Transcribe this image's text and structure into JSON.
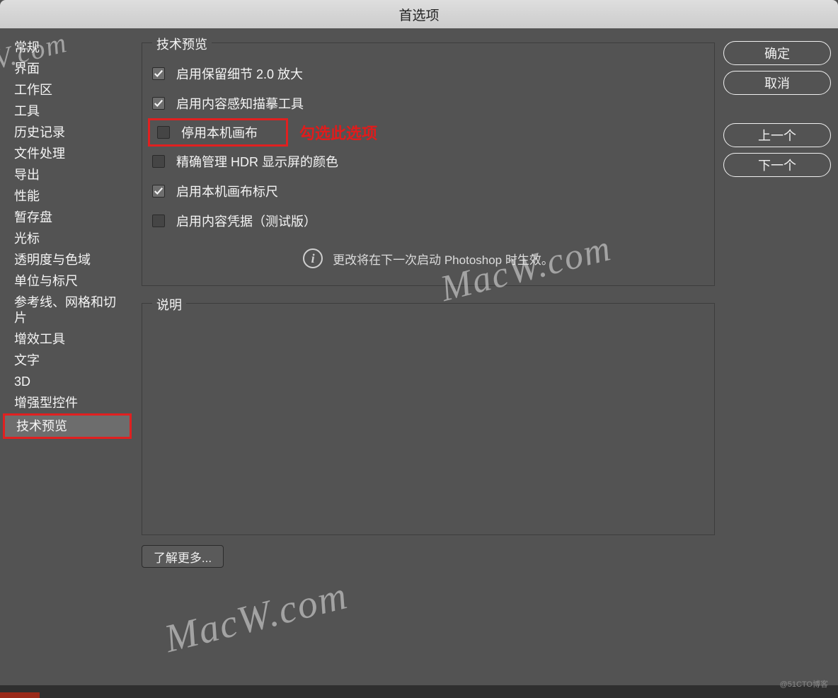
{
  "title": "首选项",
  "sidebar": {
    "items": [
      "常规",
      "界面",
      "工作区",
      "工具",
      "历史记录",
      "文件处理",
      "导出",
      "性能",
      "暂存盘",
      "光标",
      "透明度与色域",
      "单位与标尺",
      "参考线、网格和切片",
      "增效工具",
      "文字",
      "3D",
      "增强型控件",
      "技术预览"
    ],
    "selectedIndex": 17
  },
  "legend1": "技术预览",
  "checkboxes": [
    {
      "label": "启用保留细节 2.0 放大",
      "checked": true
    },
    {
      "label": "启用内容感知描摹工具",
      "checked": true
    },
    {
      "label": "停用本机画布",
      "checked": false,
      "highlight": true
    },
    {
      "label": "精确管理 HDR 显示屏的颜色",
      "checked": false
    },
    {
      "label": "启用本机画布标尺",
      "checked": true
    },
    {
      "label": "启用内容凭据（测试版）",
      "checked": false
    }
  ],
  "annotation": "勾选此选项",
  "info_text": "更改将在下一次启动 Photoshop 时生效。",
  "legend2": "说明",
  "learn_more": "了解更多...",
  "buttons": {
    "ok": "确定",
    "cancel": "取消",
    "prev": "上一个",
    "next": "下一个"
  },
  "watermark": "MacW.com",
  "wm_short": "V.com",
  "footer": "@51CTO博客"
}
